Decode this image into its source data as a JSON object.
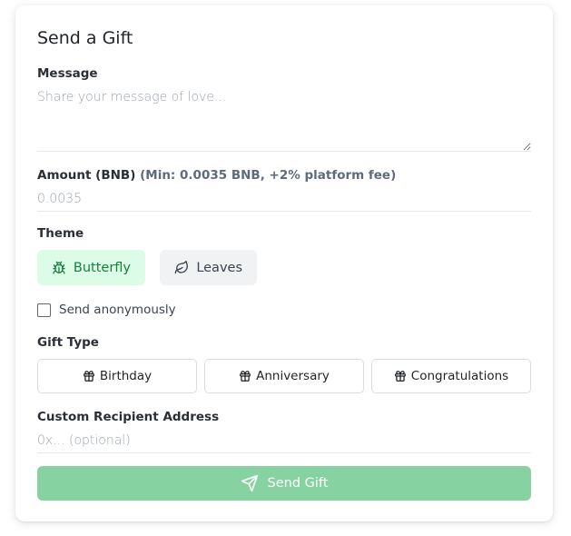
{
  "form": {
    "title": "Send a Gift",
    "message": {
      "label": "Message",
      "placeholder": "Share your message of love...",
      "value": ""
    },
    "amount": {
      "label": "Amount (BNB)",
      "hint": "(Min: 0.0035 BNB, +2% platform fee)",
      "placeholder": "0.0035",
      "value": ""
    },
    "theme": {
      "label": "Theme",
      "options": [
        {
          "label": "Butterfly",
          "icon": "bug-icon",
          "selected": true
        },
        {
          "label": "Leaves",
          "icon": "leaf-icon",
          "selected": false
        }
      ]
    },
    "anonymous": {
      "label": "Send anonymously",
      "checked": false
    },
    "gift_type": {
      "label": "Gift Type",
      "options": [
        {
          "label": "Birthday",
          "icon": "gift-icon"
        },
        {
          "label": "Anniversary",
          "icon": "gift-icon"
        },
        {
          "label": "Congratulations",
          "icon": "gift-icon"
        }
      ]
    },
    "recipient": {
      "label": "Custom Recipient Address",
      "placeholder": "0x... (optional)",
      "value": ""
    },
    "submit": {
      "label": "Send Gift",
      "icon": "send-icon",
      "disabled": true
    }
  },
  "colors": {
    "accent": "#15803d",
    "accent_bg": "#dcfce7",
    "submit_bg": "#86d3a1"
  }
}
